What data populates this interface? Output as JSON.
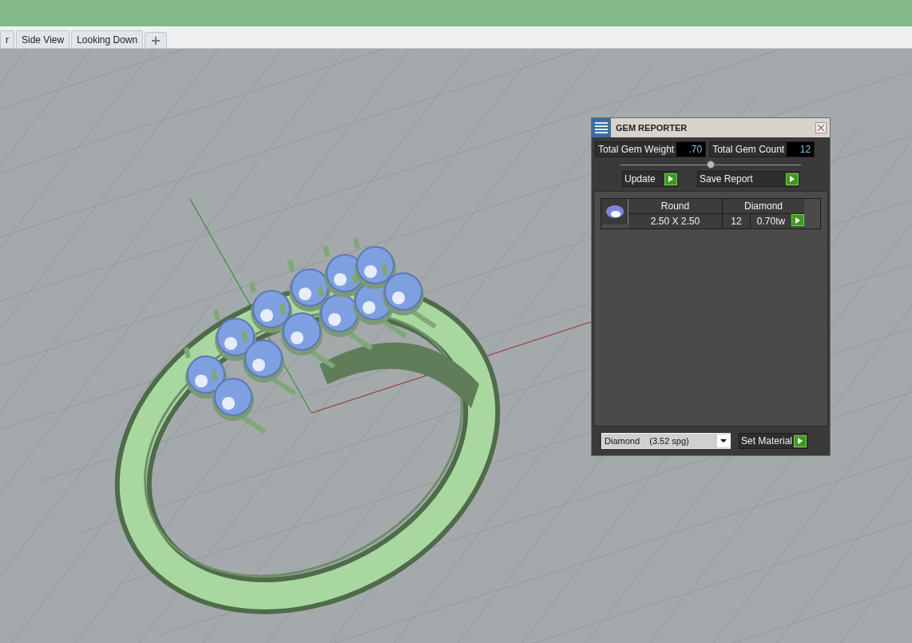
{
  "tabs": [
    {
      "label": "r",
      "selected": false
    },
    {
      "label": "Side View",
      "selected": false
    },
    {
      "label": "Looking Down",
      "selected": false
    }
  ],
  "gem_reporter": {
    "title": "GEM REPORTER",
    "total_weight": {
      "label": "Total Gem Weight",
      "value": ".70"
    },
    "total_count": {
      "label": "Total Gem Count",
      "value": "12"
    },
    "buttons": [
      "Update",
      "Save Report"
    ],
    "gems": [
      {
        "shape": "Round",
        "material": "Diamond",
        "size": "2.50 X 2.50",
        "count": "12",
        "weight": "0.70tw"
      }
    ],
    "material_select": {
      "value": "Diamond    (3.52 spg)"
    },
    "set_material": "Set Material"
  }
}
